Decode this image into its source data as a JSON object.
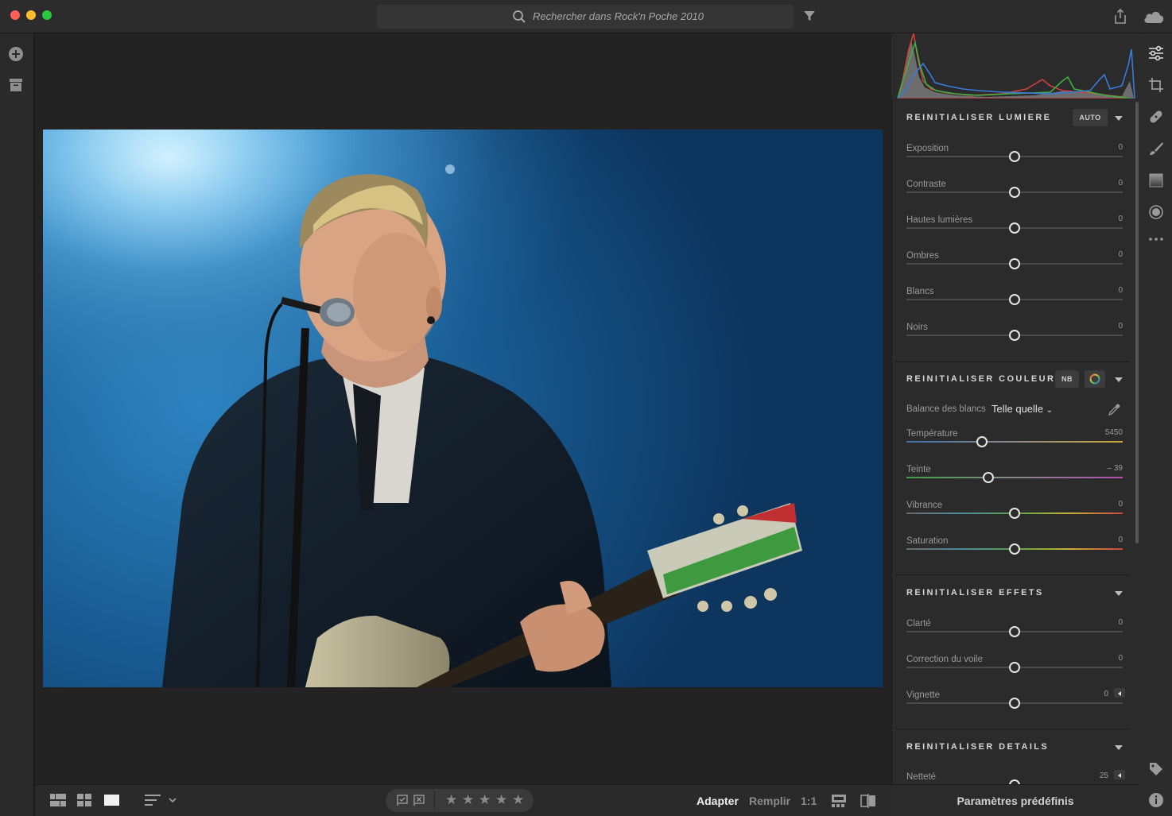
{
  "titlebar": {
    "search_placeholder": "Rechercher dans Rock'n Poche 2010"
  },
  "sections": {
    "light": {
      "title": "REINITIALISER LUMIERE",
      "auto_label": "AUTO",
      "sliders": [
        {
          "label": "Exposition",
          "value": "0"
        },
        {
          "label": "Contraste",
          "value": "0"
        },
        {
          "label": "Hautes lumières",
          "value": "0"
        },
        {
          "label": "Ombres",
          "value": "0"
        },
        {
          "label": "Blancs",
          "value": "0"
        },
        {
          "label": "Noirs",
          "value": "0"
        }
      ]
    },
    "color": {
      "title": "REINITIALISER COULEUR",
      "bw_label": "NB",
      "white_balance_label": "Balance des blancs",
      "white_balance_value": "Telle quelle",
      "sliders": [
        {
          "label": "Température",
          "value": "5450",
          "level": 0.35
        },
        {
          "label": "Teinte",
          "value": "– 39",
          "level": 0.38
        },
        {
          "label": "Vibrance",
          "value": "0",
          "level": 0.5
        },
        {
          "label": "Saturation",
          "value": "0",
          "level": 0.5
        }
      ]
    },
    "effects": {
      "title": "REINITIALISER EFFETS",
      "sliders": [
        {
          "label": "Clarté",
          "value": "0"
        },
        {
          "label": "Correction du voile",
          "value": "0"
        },
        {
          "label": "Vignette",
          "value": "0"
        }
      ]
    },
    "details": {
      "title": "REINITIALISER DETAILS",
      "sliders": [
        {
          "label": "Netteté",
          "value": "25"
        }
      ]
    }
  },
  "presets_label": "Paramètres prédéfinis",
  "zoom": {
    "fit": "Adapter",
    "fill": "Remplir",
    "one_to_one": "1:1"
  },
  "rating": {
    "stars": 5
  },
  "colors": {
    "panel_bg": "#2b2b2b",
    "accent_text": "#d6d6d6"
  }
}
